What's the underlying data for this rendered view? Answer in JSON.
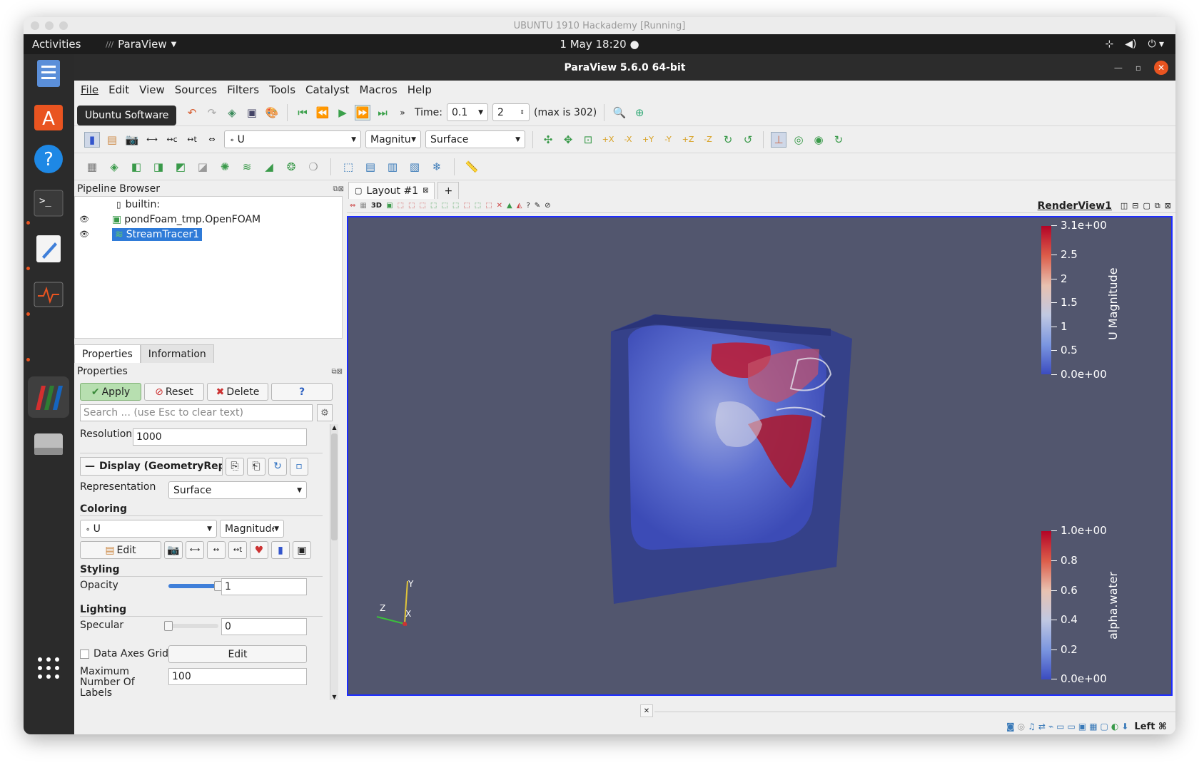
{
  "vm": {
    "title": "UBUNTU 1910 Hackademy [Running]"
  },
  "topbar": {
    "activities": "Activities",
    "app_name": "ParaView",
    "clock": "1 May  18:20"
  },
  "dock": {
    "tooltip": "Ubuntu Software"
  },
  "window": {
    "title": "ParaView 5.6.0 64-bit"
  },
  "menu": [
    "File",
    "Edit",
    "View",
    "Sources",
    "Filters",
    "Tools",
    "Catalyst",
    "Macros",
    "Help"
  ],
  "toolbar1": {
    "time_label": "Time:",
    "time_value": "0.1",
    "timestep": "2",
    "max_label": "(max is 302)"
  },
  "toolbar2": {
    "array": "U",
    "component": "Magnitude",
    "representation": "Surface"
  },
  "pipeline": {
    "title": "Pipeline Browser",
    "items": [
      {
        "label": "builtin:"
      },
      {
        "label": "pondFoam_tmp.OpenFOAM"
      },
      {
        "label": "StreamTracer1"
      }
    ]
  },
  "tabs": {
    "properties": "Properties",
    "information": "Information"
  },
  "properties": {
    "title": "Properties",
    "apply": "Apply",
    "reset": "Reset",
    "delete": "Delete",
    "help": "?",
    "search_placeholder": "Search ... (use Esc to clear text)",
    "resolution_label": "Resolution",
    "resolution_value": "1000",
    "display_header": "Display (GeometryRepr",
    "representation_label": "Representation",
    "representation_value": "Surface",
    "coloring_header": "Coloring",
    "coloring_array": "U",
    "coloring_component": "Magnitude",
    "edit_label": "Edit",
    "styling_header": "Styling",
    "opacity_label": "Opacity",
    "opacity_value": "1",
    "opacity_level": 1.0,
    "lighting_header": "Lighting",
    "specular_label": "Specular",
    "specular_value": "0",
    "specular_level": 0.0,
    "data_axes_label": "Data Axes Grid",
    "data_axes_edit": "Edit",
    "max_labels_label": "Maximum Number Of Labels",
    "max_labels_value": "100"
  },
  "layout": {
    "tab_label": "Layout #1",
    "add_tab": "+",
    "view_name": "RenderView1",
    "mode_3d": "3D"
  },
  "legend_u": {
    "title": "U Magnitude",
    "ticks": [
      "3.1e+00",
      "2.5",
      "2",
      "1.5",
      "1",
      "0.5",
      "0.0e+00"
    ],
    "colors": {
      "high": "#b40426",
      "mid": "#dddddd",
      "low": "#3b4cc0"
    }
  },
  "legend_alpha": {
    "title": "alpha.water",
    "ticks": [
      "1.0e+00",
      "0.8",
      "0.6",
      "0.4",
      "0.2",
      "0.0e+00"
    ]
  },
  "axes": {
    "y": "Y",
    "z": "Z",
    "x": "X"
  },
  "status": {
    "host_key": "Left ⌘"
  }
}
